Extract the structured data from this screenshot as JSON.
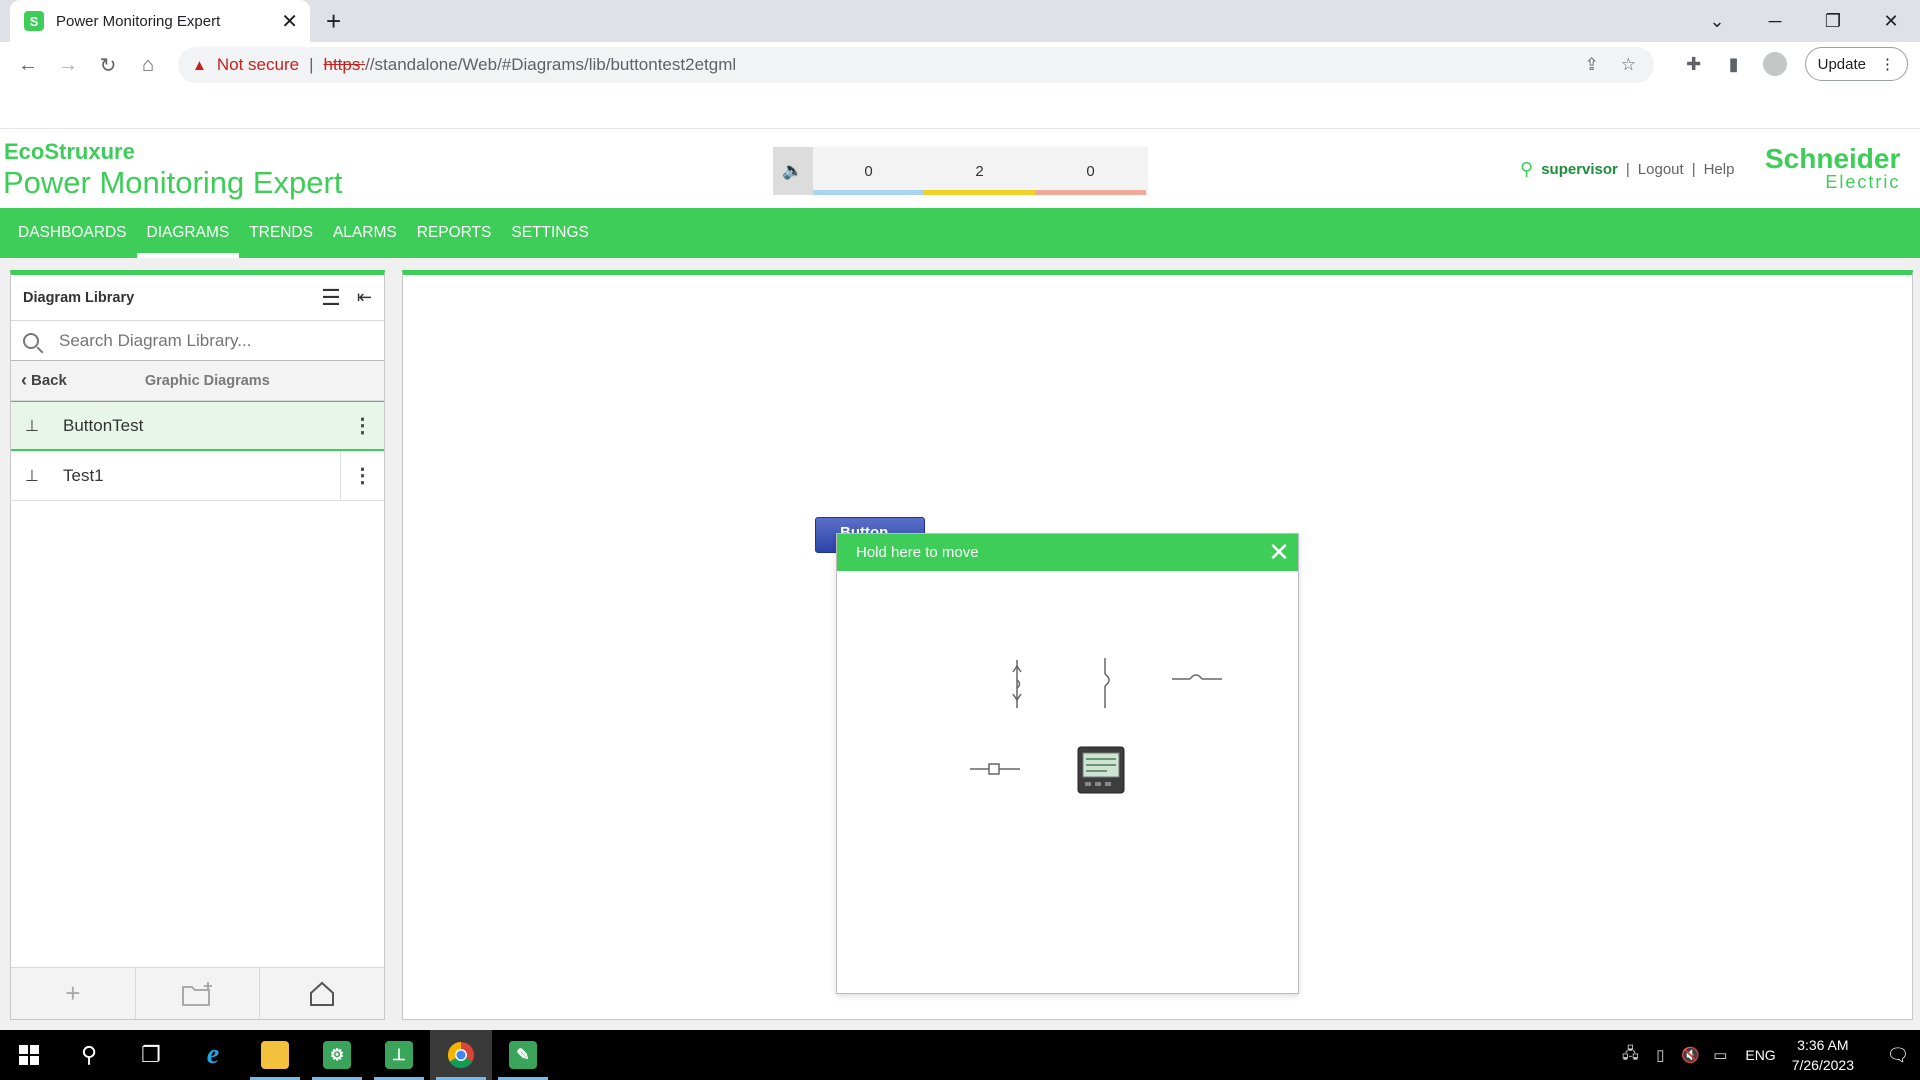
{
  "browser": {
    "tab_title": "Power Monitoring Expert",
    "security_label": "Not secure",
    "separator": "|",
    "url_protocol": "https:",
    "url_rest": "//standalone/Web/#Diagrams/lib/buttontest2etgml",
    "update_label": "Update"
  },
  "header": {
    "brand_line1": "EcoStruxure",
    "brand_line2": "Power Monitoring Expert",
    "alarms": [
      {
        "count": "0",
        "color": "#a8d4f0"
      },
      {
        "count": "2",
        "color": "#f2d02a"
      },
      {
        "count": "0",
        "color": "#f0a898"
      }
    ],
    "user_name": "supervisor",
    "separator": "|",
    "logout_label": "Logout",
    "help_label": "Help",
    "company_line1": "Schneider",
    "company_line2": "Electric"
  },
  "nav": {
    "items": [
      "DASHBOARDS",
      "DIAGRAMS",
      "TRENDS",
      "ALARMS",
      "REPORTS",
      "SETTINGS"
    ],
    "active": "DIAGRAMS"
  },
  "library": {
    "title": "Diagram Library",
    "search_placeholder": "Search Diagram Library...",
    "back_label": "Back",
    "path_label": "Graphic Diagrams",
    "items": [
      {
        "label": "ButtonTest",
        "selected": true
      },
      {
        "label": "Test1",
        "selected": false
      }
    ]
  },
  "canvas": {
    "button_label": "Button"
  },
  "popup": {
    "title": "Hold here to move"
  },
  "taskbar": {
    "language": "ENG",
    "time": "3:36 AM",
    "date": "7/26/2023"
  },
  "colors": {
    "brand_green": "#3dcd58",
    "dark_green": "#1b8f3a",
    "button_blue": "#2c44a8"
  }
}
